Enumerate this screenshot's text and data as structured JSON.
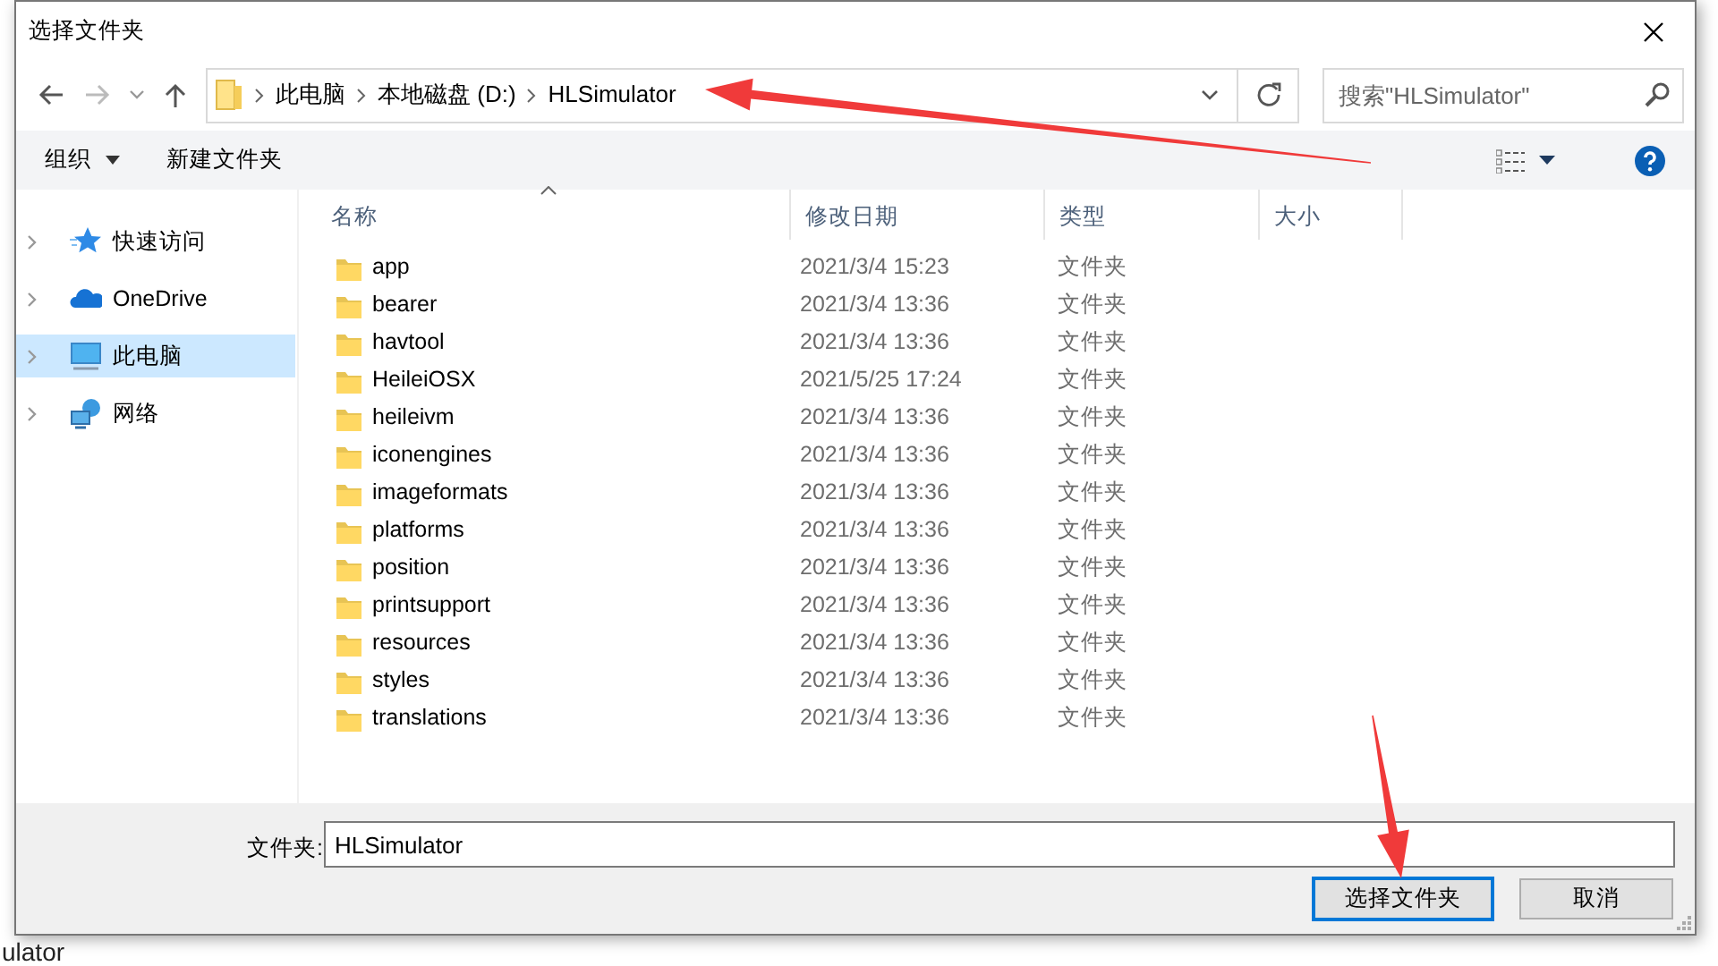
{
  "window": {
    "title": "选择文件夹"
  },
  "breadcrumb": [
    "此电脑",
    "本地磁盘 (D:)",
    "HLSimulator"
  ],
  "search": {
    "placeholder": "搜索\"HLSimulator\""
  },
  "toolbar": [
    {
      "label": "组织",
      "dropdown": true
    },
    {
      "label": "新建文件夹",
      "dropdown": false
    }
  ],
  "sidebar": {
    "items": [
      {
        "label": "快速访问",
        "kind": "star",
        "selected": false
      },
      {
        "label": "OneDrive",
        "kind": "cloud",
        "selected": false
      },
      {
        "label": "此电脑",
        "kind": "computer",
        "selected": true
      },
      {
        "label": "网络",
        "kind": "network",
        "selected": false
      }
    ]
  },
  "table": {
    "columns": [
      {
        "label": "名称",
        "sorted": true
      },
      {
        "label": "修改日期",
        "sorted": false
      },
      {
        "label": "类型",
        "sorted": false
      },
      {
        "label": "大小",
        "sorted": false
      }
    ],
    "rows": [
      {
        "name": "app",
        "modified": "2021/3/4 15:23",
        "type": "文件夹"
      },
      {
        "name": "bearer",
        "modified": "2021/3/4 13:36",
        "type": "文件夹"
      },
      {
        "name": "havtool",
        "modified": "2021/3/4 13:36",
        "type": "文件夹"
      },
      {
        "name": "HeileiOSX",
        "modified": "2021/5/25 17:24",
        "type": "文件夹"
      },
      {
        "name": "heileivm",
        "modified": "2021/3/4 13:36",
        "type": "文件夹"
      },
      {
        "name": "iconengines",
        "modified": "2021/3/4 13:36",
        "type": "文件夹"
      },
      {
        "name": "imageformats",
        "modified": "2021/3/4 13:36",
        "type": "文件夹"
      },
      {
        "name": "platforms",
        "modified": "2021/3/4 13:36",
        "type": "文件夹"
      },
      {
        "name": "position",
        "modified": "2021/3/4 13:36",
        "type": "文件夹"
      },
      {
        "name": "printsupport",
        "modified": "2021/3/4 13:36",
        "type": "文件夹"
      },
      {
        "name": "resources",
        "modified": "2021/3/4 13:36",
        "type": "文件夹"
      },
      {
        "name": "styles",
        "modified": "2021/3/4 13:36",
        "type": "文件夹"
      },
      {
        "name": "translations",
        "modified": "2021/3/4 13:36",
        "type": "文件夹"
      }
    ]
  },
  "folder_field": {
    "label": "文件夹:",
    "value": "HLSimulator"
  },
  "buttons": [
    {
      "label": "选择文件夹",
      "default": true
    },
    {
      "label": "取消",
      "default": false
    }
  ],
  "background_text": "ulator",
  "annotations": [
    {
      "kind": "arrow"
    },
    {
      "kind": "arrow"
    }
  ]
}
